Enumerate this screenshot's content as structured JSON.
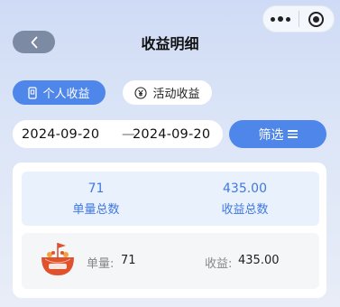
{
  "header": {
    "title": "收益明细"
  },
  "tabs": [
    {
      "label": "个人收益",
      "icon": "card-icon",
      "active": true
    },
    {
      "label": "活动收益",
      "icon": "yen-icon",
      "active": false
    }
  ],
  "date_range": {
    "start": "2024-09-20",
    "separator": "—",
    "end": "2024-09-20"
  },
  "filter": {
    "label": "筛选"
  },
  "summary": {
    "order_count": "71",
    "order_count_label": "单量总数",
    "income_total": "435.00",
    "income_total_label": "收益总数"
  },
  "records": [
    {
      "qty_label": "单量:",
      "qty": "71",
      "income_label": "收益:",
      "income": "435.00"
    }
  ],
  "colors": {
    "accent": "#4f86ea",
    "summary_text": "#3f78e0",
    "logo_red": "#e0522d"
  }
}
